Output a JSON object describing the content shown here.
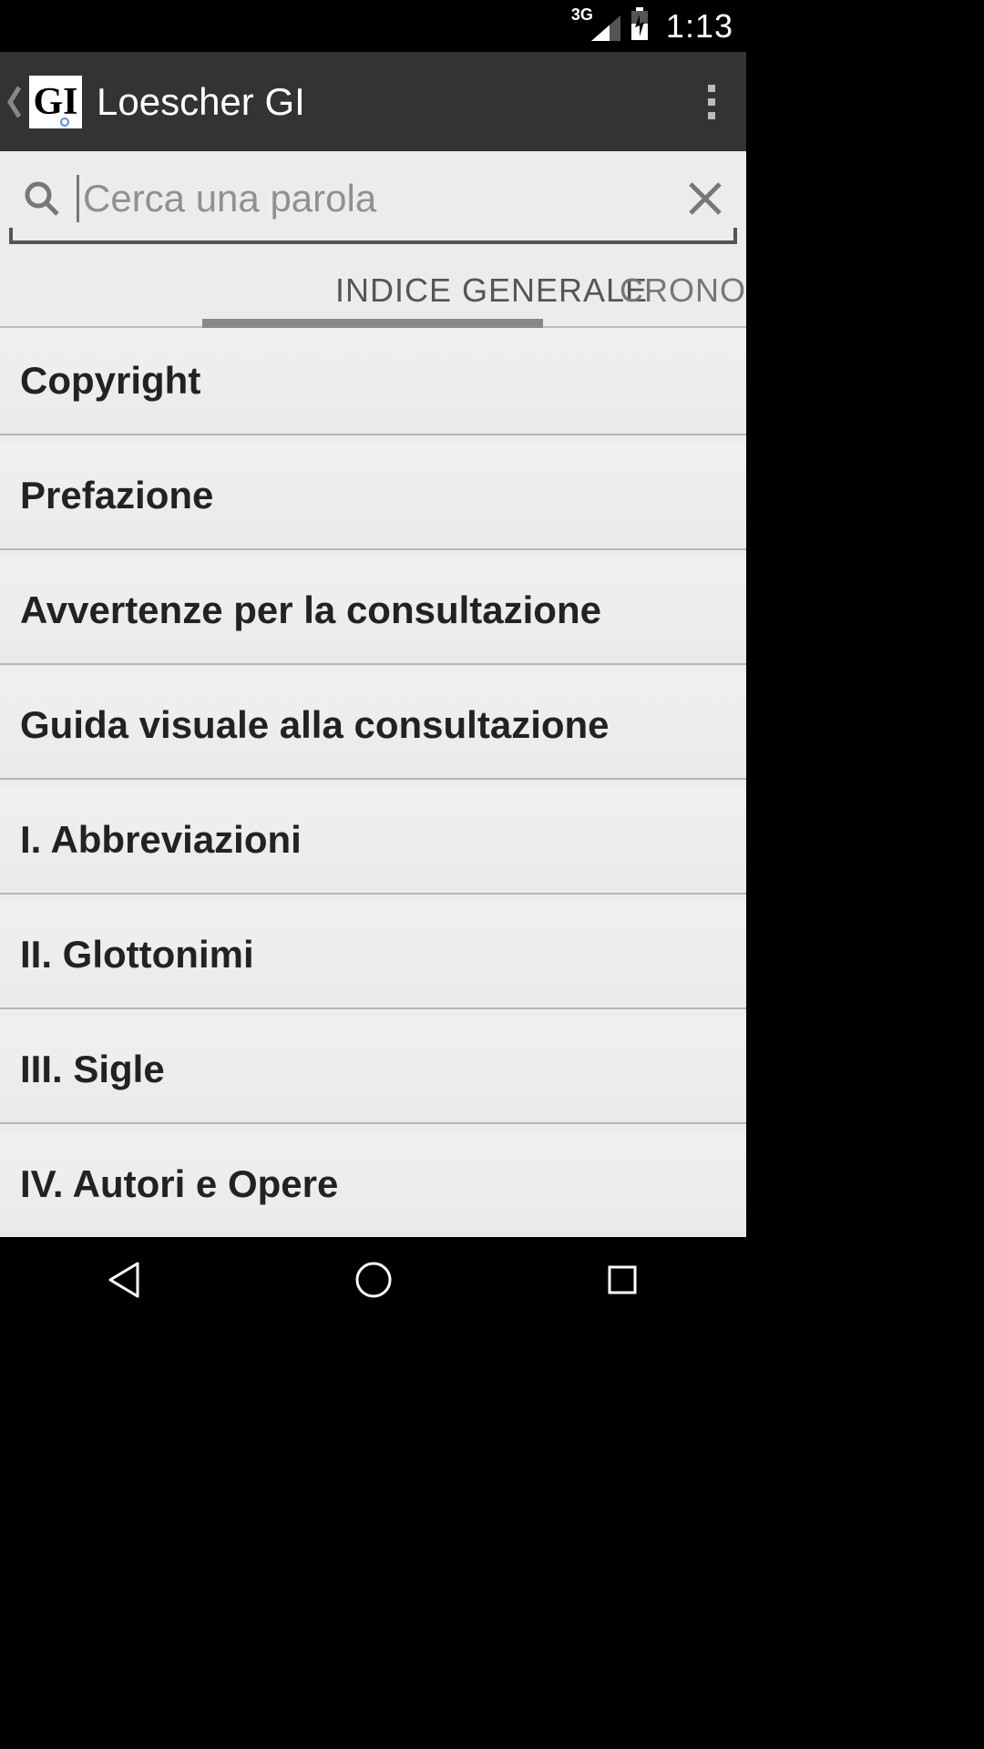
{
  "status": {
    "network_label": "3G",
    "time": "1:13"
  },
  "header": {
    "title": "Loescher GI",
    "app_icon_text": "GI"
  },
  "search": {
    "placeholder": "Cerca una parola",
    "value": ""
  },
  "tabs": {
    "active": "INDICE GENERALE",
    "next_partial": "CRONO"
  },
  "index_items": [
    "Copyright",
    "Prefazione",
    "Avvertenze per la consultazione",
    "Guida visuale alla consultazione",
    "I. Abbreviazioni",
    "II. Glottonimi",
    "III. Sigle",
    "IV. Autori e Opere"
  ]
}
